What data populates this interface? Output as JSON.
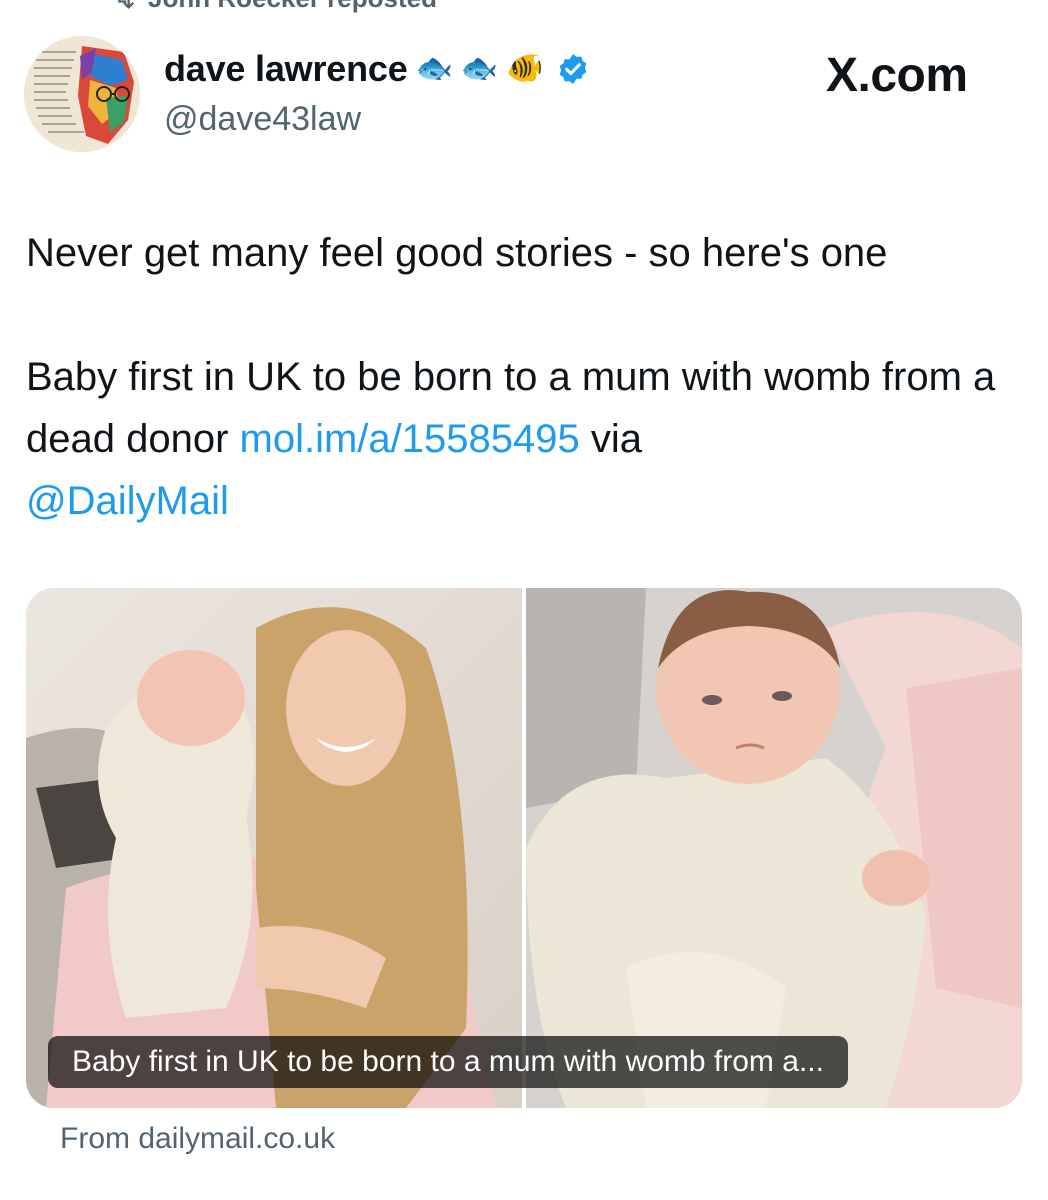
{
  "repost": {
    "label": "John Roecker reposted"
  },
  "author": {
    "display_name": "dave lawrence",
    "emojis": [
      "🐟",
      "🐟",
      "🐠"
    ],
    "handle": "@dave43law",
    "verified": true
  },
  "watermark": "X.com",
  "tweet": {
    "line1": "Never get many feel good stories - so here's one",
    "line2_text": "Baby first in UK to be born to a mum with womb from a dead donor ",
    "link": "mol.im/a/15585495",
    "via": " via ",
    "mention": "@DailyMail"
  },
  "card": {
    "caption": "Baby first in UK to be born to a mum with womb from a...",
    "source": "From dailymail.co.uk"
  },
  "colors": {
    "link": "#1d9bf0",
    "secondary": "#536471",
    "verified": "#1d9bf0"
  }
}
